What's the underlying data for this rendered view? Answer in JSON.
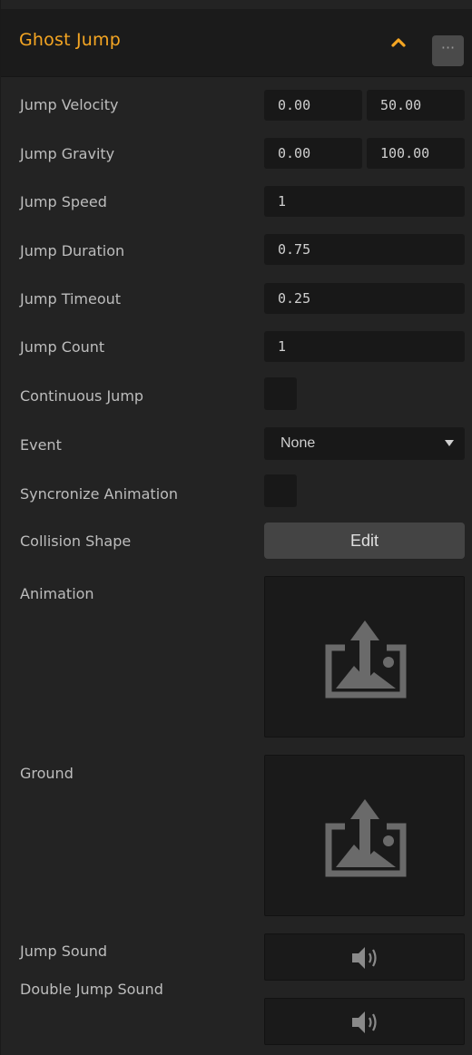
{
  "header": {
    "title": "Ghost Jump",
    "more_label": "···"
  },
  "rows": {
    "jump_velocity": {
      "label": "Jump Velocity",
      "x": "0.00",
      "y": "50.00"
    },
    "jump_gravity": {
      "label": "Jump Gravity",
      "x": "0.00",
      "y": "100.00"
    },
    "jump_speed": {
      "label": "Jump Speed",
      "value": "1"
    },
    "jump_duration": {
      "label": "Jump Duration",
      "value": "0.75"
    },
    "jump_timeout": {
      "label": "Jump Timeout",
      "value": "0.25"
    },
    "jump_count": {
      "label": "Jump Count",
      "value": "1"
    },
    "continuous_jump": {
      "label": "Continuous Jump",
      "checked": false
    },
    "event": {
      "label": "Event",
      "value": "None"
    },
    "syncronize_animation": {
      "label": "Syncronize Animation",
      "checked": false
    },
    "collision_shape": {
      "label": "Collision Shape",
      "button": "Edit"
    },
    "animation": {
      "label": "Animation",
      "icon": "image-upload-icon"
    },
    "ground": {
      "label": "Ground",
      "icon": "image-upload-icon"
    },
    "jump_sound": {
      "label": "Jump Sound",
      "icon": "speaker-icon"
    },
    "double_jump_sound": {
      "label": "Double Jump Sound",
      "icon": "speaker-icon"
    }
  },
  "colors": {
    "accent": "#f5a623",
    "panel_bg": "#232323",
    "field_bg": "#181818",
    "icon_gray": "#6a6a6a"
  }
}
